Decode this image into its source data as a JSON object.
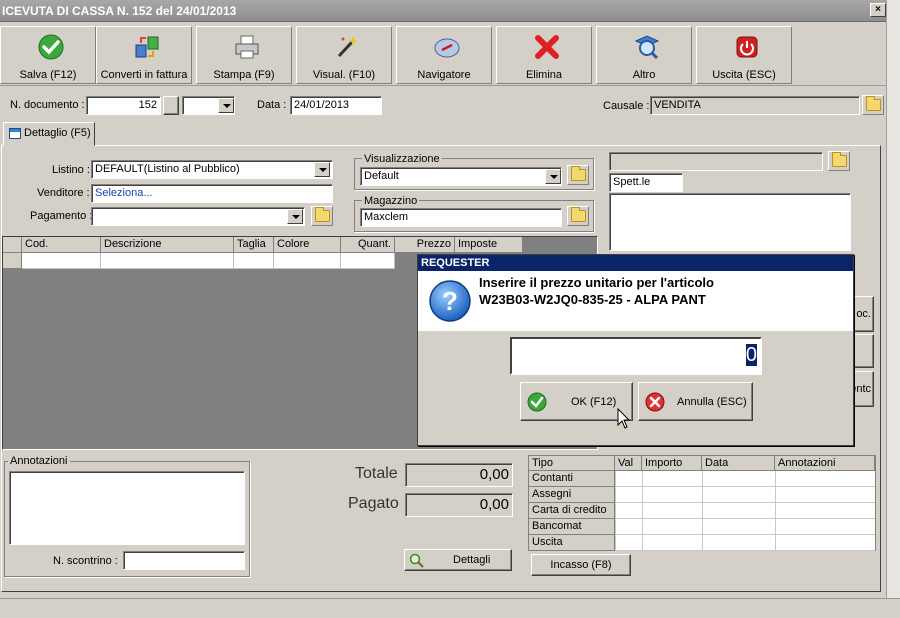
{
  "window": {
    "title": "ICEVUTA DI CASSA N. 152 del 24/01/2013",
    "close_label": "×"
  },
  "toolbar": {
    "buttons": [
      {
        "label": "Salva (F12)",
        "icon": "check-icon"
      },
      {
        "label": "Converti in fattura",
        "icon": "convert-icon"
      },
      {
        "label": "Stampa (F9)",
        "icon": "printer-icon"
      },
      {
        "label": "Visual. (F10)",
        "icon": "magic-wand-icon"
      },
      {
        "label": "Navigatore",
        "icon": "compass-icon"
      },
      {
        "label": "Elimina",
        "icon": "delete-icon"
      },
      {
        "label": "Altro",
        "icon": "magnifier-icon"
      },
      {
        "label": "Uscita (ESC)",
        "icon": "power-icon"
      }
    ]
  },
  "header": {
    "ndoc_label": "N. documento :",
    "ndoc_value": "152",
    "data_label": "Data :",
    "data_value": "24/01/2013",
    "causale_label": "Causale :",
    "causale_value": "VENDITA"
  },
  "tab": {
    "label": "Dettaglio (F5)"
  },
  "form": {
    "listino_label": "Listino :",
    "listino_value": "DEFAULT(Listino al Pubblico)",
    "venditore_label": "Venditore :",
    "venditore_value": "Seleziona...",
    "pagamento_label": "Pagamento :",
    "pagamento_value": "",
    "visualizzazione_label": "Visualizzazione",
    "visualizzazione_value": "Default",
    "magazzino_label": "Magazzino",
    "magazzino_value": "Maxclem"
  },
  "customer": {
    "top_value": "",
    "spett_value": "Spett.le"
  },
  "grid": {
    "columns": [
      "Cod.",
      "Descrizione",
      "Taglia",
      "Colore",
      "Quant.",
      "Prezzo",
      "Imposte"
    ]
  },
  "annotazioni": {
    "label": "Annotazioni",
    "scontrino_label": "N. scontrino :"
  },
  "totals": {
    "totale_label": "Totale",
    "totale_value": "0,00",
    "pagato_label": "Pagato",
    "pagato_value": "0,00",
    "dettagli_label": "Dettagli"
  },
  "payments": {
    "columns": [
      "Tipo",
      "Val",
      "Importo",
      "Data",
      "Annotazioni"
    ],
    "rows": [
      "Contanti",
      "Assegni",
      "Carta di credito",
      "Bancomat",
      "Uscita"
    ],
    "incasso_label": "Incasso (F8)"
  },
  "side_buttons": {
    "doc_label": "oc.",
    "enti_label": "entc"
  },
  "dialog": {
    "title": "REQUESTER",
    "message_line1": "Inserire il prezzo unitario per l'articolo",
    "message_line2": "W23B03-W2JQ0-835-25 - ALPA PANT",
    "input_value": "0",
    "ok_label": "OK (F12)",
    "cancel_label": "Annulla (ESC)"
  }
}
